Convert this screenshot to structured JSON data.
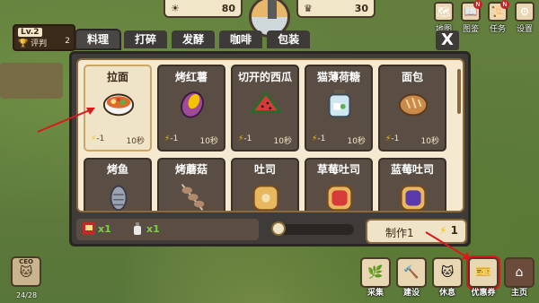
{
  "hud": {
    "left_value": "80",
    "right_value": "30"
  },
  "player": {
    "level": "Lv.2",
    "rating_label": "评判",
    "rating_value": "2"
  },
  "top_icons": [
    {
      "label": "地图",
      "icon": "map-icon",
      "badge": ""
    },
    {
      "label": "图鉴",
      "icon": "book-icon",
      "badge": "N"
    },
    {
      "label": "任务",
      "icon": "quest-icon",
      "badge": "N"
    },
    {
      "label": "设置",
      "icon": "gear-icon",
      "badge": ""
    }
  ],
  "tabs": [
    "料理",
    "打碎",
    "发酵",
    "咖啡",
    "包装"
  ],
  "active_tab": 0,
  "close_label": "X",
  "recipes": [
    {
      "name": "拉面",
      "energy": "-1",
      "time": "10秒",
      "icon": "ramen-icon",
      "color": "#e06a2a"
    },
    {
      "name": "烤红薯",
      "energy": "-1",
      "time": "10秒",
      "icon": "sweet-potato-icon",
      "color": "#a04a9a"
    },
    {
      "name": "切开的西瓜",
      "energy": "-1",
      "time": "10秒",
      "icon": "watermelon-icon",
      "color": "#d83a3a"
    },
    {
      "name": "猫薄荷糖",
      "energy": "-1",
      "time": "10秒",
      "icon": "candy-jar-icon",
      "color": "#cfe8ef"
    },
    {
      "name": "面包",
      "energy": "-1",
      "time": "10秒",
      "icon": "bread-icon",
      "color": "#c98a4a"
    },
    {
      "name": "烤鱼",
      "icon": "grilled-fish-icon",
      "color": "#9aa3b0"
    },
    {
      "name": "烤蘑菇",
      "icon": "mushroom-skewer-icon",
      "color": "#b08a6a"
    },
    {
      "name": "吐司",
      "icon": "toast-icon",
      "color": "#e8b860"
    },
    {
      "name": "草莓吐司",
      "icon": "strawberry-toast-icon",
      "color": "#d83a3a"
    },
    {
      "name": "蓝莓吐司",
      "icon": "blueberry-toast-icon",
      "color": "#5a3aa8"
    }
  ],
  "materials": [
    {
      "count": "x1",
      "icon": "noodle-pack-icon"
    },
    {
      "count": "x1",
      "icon": "bottle-icon"
    }
  ],
  "make_button": {
    "label": "制作1",
    "cost": "1"
  },
  "ceo": {
    "badge": "CEO",
    "progress": "24/28"
  },
  "dock": [
    {
      "label": "采集",
      "icon": "gather-icon"
    },
    {
      "label": "建设",
      "icon": "build-icon"
    },
    {
      "label": "休息",
      "icon": "rest-icon"
    },
    {
      "label": "优惠券",
      "icon": "coupon-icon"
    },
    {
      "label": "主页",
      "icon": "home-icon"
    }
  ]
}
